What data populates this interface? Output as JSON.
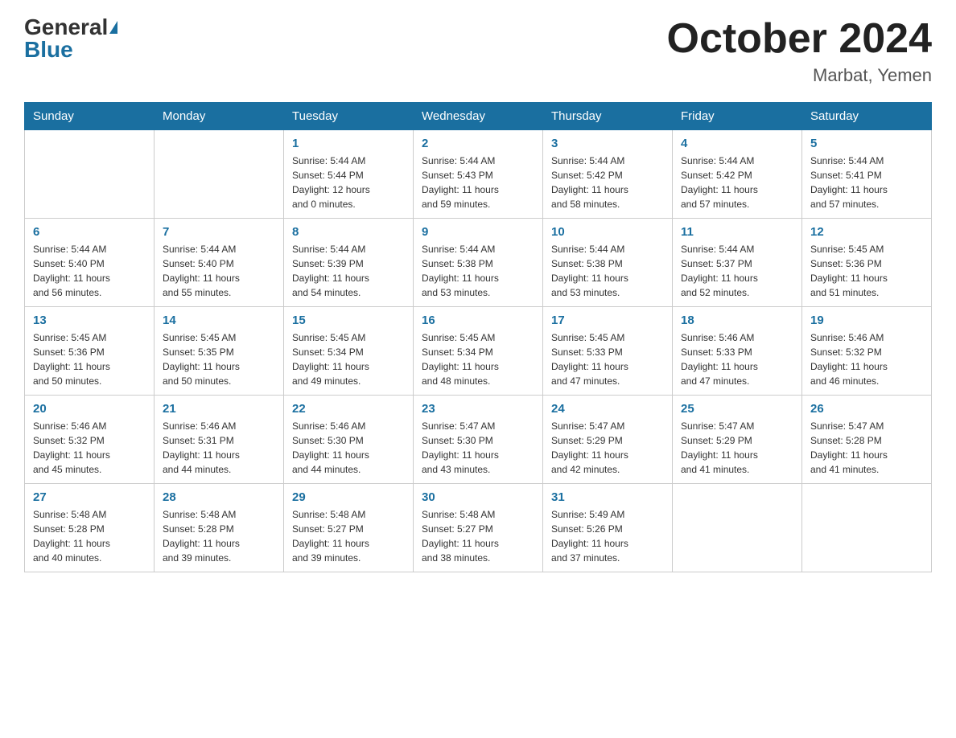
{
  "header": {
    "logo_general": "General",
    "logo_blue": "Blue",
    "month_title": "October 2024",
    "location": "Marbat, Yemen"
  },
  "days_of_week": [
    "Sunday",
    "Monday",
    "Tuesday",
    "Wednesday",
    "Thursday",
    "Friday",
    "Saturday"
  ],
  "weeks": [
    [
      {
        "day": "",
        "info": ""
      },
      {
        "day": "",
        "info": ""
      },
      {
        "day": "1",
        "info": "Sunrise: 5:44 AM\nSunset: 5:44 PM\nDaylight: 12 hours\nand 0 minutes."
      },
      {
        "day": "2",
        "info": "Sunrise: 5:44 AM\nSunset: 5:43 PM\nDaylight: 11 hours\nand 59 minutes."
      },
      {
        "day": "3",
        "info": "Sunrise: 5:44 AM\nSunset: 5:42 PM\nDaylight: 11 hours\nand 58 minutes."
      },
      {
        "day": "4",
        "info": "Sunrise: 5:44 AM\nSunset: 5:42 PM\nDaylight: 11 hours\nand 57 minutes."
      },
      {
        "day": "5",
        "info": "Sunrise: 5:44 AM\nSunset: 5:41 PM\nDaylight: 11 hours\nand 57 minutes."
      }
    ],
    [
      {
        "day": "6",
        "info": "Sunrise: 5:44 AM\nSunset: 5:40 PM\nDaylight: 11 hours\nand 56 minutes."
      },
      {
        "day": "7",
        "info": "Sunrise: 5:44 AM\nSunset: 5:40 PM\nDaylight: 11 hours\nand 55 minutes."
      },
      {
        "day": "8",
        "info": "Sunrise: 5:44 AM\nSunset: 5:39 PM\nDaylight: 11 hours\nand 54 minutes."
      },
      {
        "day": "9",
        "info": "Sunrise: 5:44 AM\nSunset: 5:38 PM\nDaylight: 11 hours\nand 53 minutes."
      },
      {
        "day": "10",
        "info": "Sunrise: 5:44 AM\nSunset: 5:38 PM\nDaylight: 11 hours\nand 53 minutes."
      },
      {
        "day": "11",
        "info": "Sunrise: 5:44 AM\nSunset: 5:37 PM\nDaylight: 11 hours\nand 52 minutes."
      },
      {
        "day": "12",
        "info": "Sunrise: 5:45 AM\nSunset: 5:36 PM\nDaylight: 11 hours\nand 51 minutes."
      }
    ],
    [
      {
        "day": "13",
        "info": "Sunrise: 5:45 AM\nSunset: 5:36 PM\nDaylight: 11 hours\nand 50 minutes."
      },
      {
        "day": "14",
        "info": "Sunrise: 5:45 AM\nSunset: 5:35 PM\nDaylight: 11 hours\nand 50 minutes."
      },
      {
        "day": "15",
        "info": "Sunrise: 5:45 AM\nSunset: 5:34 PM\nDaylight: 11 hours\nand 49 minutes."
      },
      {
        "day": "16",
        "info": "Sunrise: 5:45 AM\nSunset: 5:34 PM\nDaylight: 11 hours\nand 48 minutes."
      },
      {
        "day": "17",
        "info": "Sunrise: 5:45 AM\nSunset: 5:33 PM\nDaylight: 11 hours\nand 47 minutes."
      },
      {
        "day": "18",
        "info": "Sunrise: 5:46 AM\nSunset: 5:33 PM\nDaylight: 11 hours\nand 47 minutes."
      },
      {
        "day": "19",
        "info": "Sunrise: 5:46 AM\nSunset: 5:32 PM\nDaylight: 11 hours\nand 46 minutes."
      }
    ],
    [
      {
        "day": "20",
        "info": "Sunrise: 5:46 AM\nSunset: 5:32 PM\nDaylight: 11 hours\nand 45 minutes."
      },
      {
        "day": "21",
        "info": "Sunrise: 5:46 AM\nSunset: 5:31 PM\nDaylight: 11 hours\nand 44 minutes."
      },
      {
        "day": "22",
        "info": "Sunrise: 5:46 AM\nSunset: 5:30 PM\nDaylight: 11 hours\nand 44 minutes."
      },
      {
        "day": "23",
        "info": "Sunrise: 5:47 AM\nSunset: 5:30 PM\nDaylight: 11 hours\nand 43 minutes."
      },
      {
        "day": "24",
        "info": "Sunrise: 5:47 AM\nSunset: 5:29 PM\nDaylight: 11 hours\nand 42 minutes."
      },
      {
        "day": "25",
        "info": "Sunrise: 5:47 AM\nSunset: 5:29 PM\nDaylight: 11 hours\nand 41 minutes."
      },
      {
        "day": "26",
        "info": "Sunrise: 5:47 AM\nSunset: 5:28 PM\nDaylight: 11 hours\nand 41 minutes."
      }
    ],
    [
      {
        "day": "27",
        "info": "Sunrise: 5:48 AM\nSunset: 5:28 PM\nDaylight: 11 hours\nand 40 minutes."
      },
      {
        "day": "28",
        "info": "Sunrise: 5:48 AM\nSunset: 5:28 PM\nDaylight: 11 hours\nand 39 minutes."
      },
      {
        "day": "29",
        "info": "Sunrise: 5:48 AM\nSunset: 5:27 PM\nDaylight: 11 hours\nand 39 minutes."
      },
      {
        "day": "30",
        "info": "Sunrise: 5:48 AM\nSunset: 5:27 PM\nDaylight: 11 hours\nand 38 minutes."
      },
      {
        "day": "31",
        "info": "Sunrise: 5:49 AM\nSunset: 5:26 PM\nDaylight: 11 hours\nand 37 minutes."
      },
      {
        "day": "",
        "info": ""
      },
      {
        "day": "",
        "info": ""
      }
    ]
  ]
}
